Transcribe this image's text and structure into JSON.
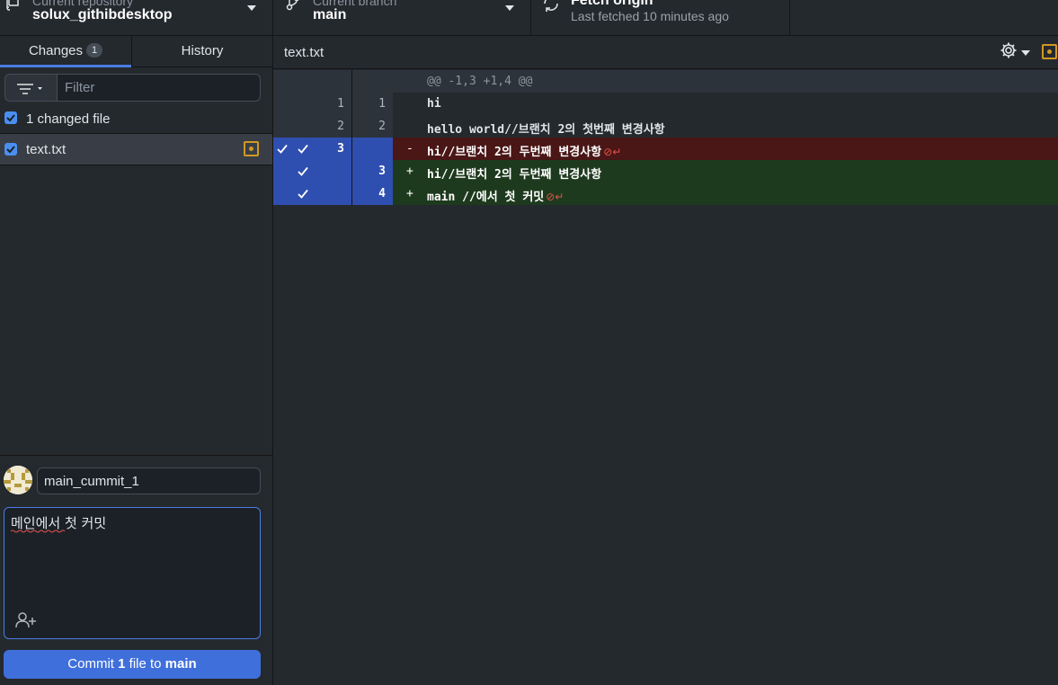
{
  "toolbar": {
    "repo": {
      "sub": "Current repository",
      "name": "solux_githibdesktop"
    },
    "branch": {
      "sub": "Current branch",
      "name": "main"
    },
    "fetch": {
      "title": "Fetch origin",
      "sub": "Last fetched 10 minutes ago"
    }
  },
  "sidebar": {
    "tabs": {
      "changes": "Changes",
      "changes_count": "1",
      "history": "History"
    },
    "filter": {
      "placeholder": "Filter"
    },
    "changed_files_label": "1 changed file",
    "files": [
      {
        "name": "text.txt",
        "status": "modified"
      }
    ],
    "commit": {
      "summary": "main_cummit_1",
      "description": "메인에서 첫 커밋",
      "button": {
        "prefix": "Commit ",
        "count": "1",
        "middle": " file to ",
        "branch": "main"
      }
    }
  },
  "diff": {
    "filename": "text.txt",
    "hunk_header": "@@ -1,3 +1,4 @@",
    "lines": [
      {
        "old": "1",
        "new": "1",
        "sign": "",
        "text": "hi"
      },
      {
        "old": "2",
        "new": "2",
        "sign": "",
        "text": "hello world//브랜치 2의 첫번째 변경사항"
      },
      {
        "old": "3",
        "new": "",
        "sign": "-",
        "text": "hi//브랜치 2의 두번째 변경사항"
      },
      {
        "old": "",
        "new": "3",
        "sign": "+",
        "text": "hi//브랜치 2의 두번째 변경사항"
      },
      {
        "old": "",
        "new": "4",
        "sign": "+",
        "text": "main //에서 첫 커밋"
      }
    ]
  },
  "colors": {
    "accent": "#3f6fdb",
    "selected_gutter": "#2f4fb0",
    "deleted_line": "#4a1616",
    "added_line": "#1e3a1e",
    "modified_icon": "#d29922"
  }
}
